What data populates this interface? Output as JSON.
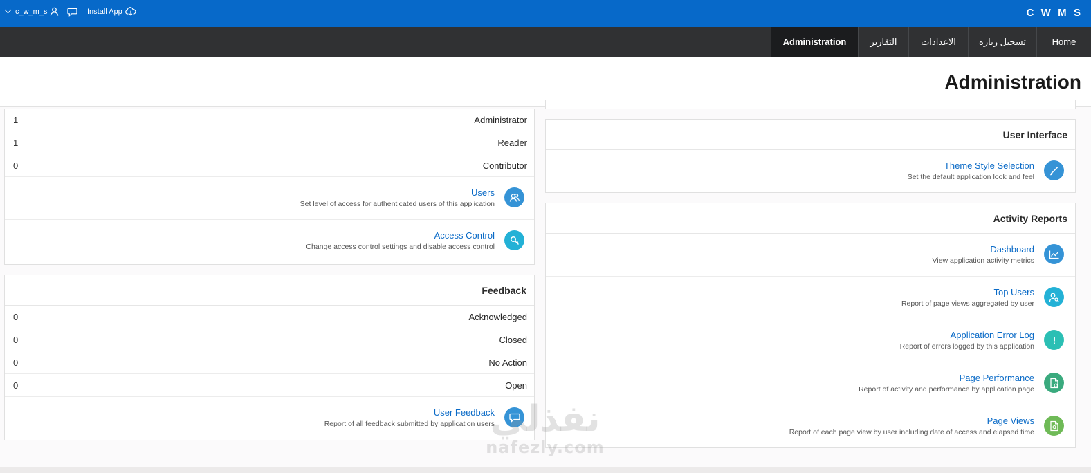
{
  "header": {
    "brand": "C_W_M_S",
    "username": "c_w_m_s",
    "install_label": "Install App"
  },
  "nav": {
    "items": [
      {
        "label": "Administration",
        "active": true
      },
      {
        "label": "التقارير"
      },
      {
        "label": "الاعدادات"
      },
      {
        "label": "تسجيل زياره"
      },
      {
        "label": "Home"
      }
    ]
  },
  "page": {
    "title": "Administration"
  },
  "access": {
    "rows": [
      {
        "label": "Administrator",
        "count": "1"
      },
      {
        "label": "Reader",
        "count": "1"
      },
      {
        "label": "Contributor",
        "count": "0"
      }
    ],
    "links": [
      {
        "name": "Users",
        "desc": "Set level of access for authenticated users of this application",
        "icon": "users-icon",
        "color": "#3593d6"
      },
      {
        "name": "Access Control",
        "desc": "Change access control settings and disable access control",
        "icon": "key-icon",
        "color": "#23b1d6"
      }
    ]
  },
  "feedback": {
    "title": "Feedback",
    "rows": [
      {
        "label": "Acknowledged",
        "count": "0"
      },
      {
        "label": "Closed",
        "count": "0"
      },
      {
        "label": "No Action",
        "count": "0"
      },
      {
        "label": "Open",
        "count": "0"
      }
    ],
    "links": [
      {
        "name": "User Feedback",
        "desc": "Report of all feedback submitted by application users",
        "icon": "chat-icon",
        "color": "#3593d6"
      }
    ]
  },
  "ui": {
    "title": "User Interface",
    "links": [
      {
        "name": "Theme Style Selection",
        "desc": "Set the default application look and feel",
        "icon": "brush-icon",
        "color": "#3593d6"
      }
    ]
  },
  "activity": {
    "title": "Activity Reports",
    "links": [
      {
        "name": "Dashboard",
        "desc": "View application activity metrics",
        "icon": "chart-icon",
        "color": "#3593d6"
      },
      {
        "name": "Top Users",
        "desc": "Report of page views aggregated by user",
        "icon": "user-search-icon",
        "color": "#23b1d6"
      },
      {
        "name": "Application Error Log",
        "desc": "Report of errors logged by this application",
        "icon": "exclamation-icon",
        "color": "#2bbfb4"
      },
      {
        "name": "Page Performance",
        "desc": "Report of activity and performance by application page",
        "icon": "page-performance-icon",
        "color": "#3aaa7e"
      },
      {
        "name": "Page Views",
        "desc": "Report of each page view by user including date of access and elapsed time",
        "icon": "page-search-icon",
        "color": "#6fba57"
      }
    ]
  },
  "watermark": {
    "arabic": "نفذلي",
    "latin": "nafezly.com"
  }
}
